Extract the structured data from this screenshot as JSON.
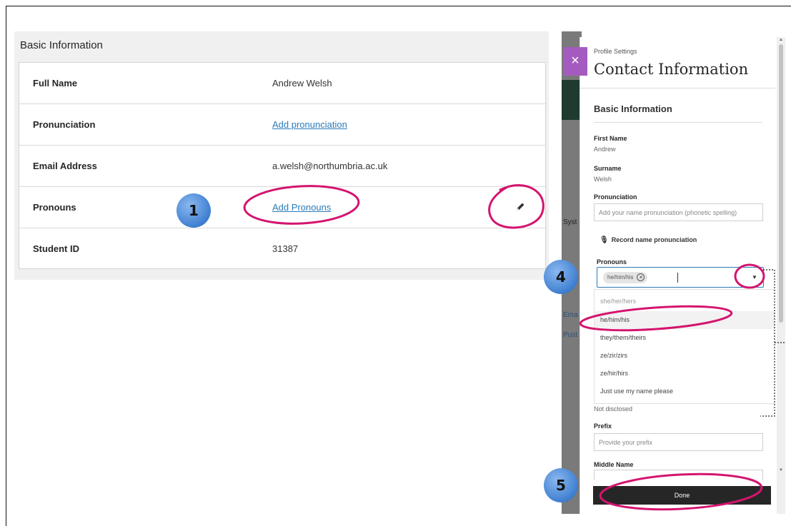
{
  "basic_info": {
    "title": "Basic Information",
    "rows": [
      {
        "label": "Full Name",
        "value": "Andrew Welsh",
        "link": false
      },
      {
        "label": "Pronunciation",
        "value": "Add pronunciation",
        "link": true
      },
      {
        "label": "Email Address",
        "value": "a.welsh@northumbria.ac.uk",
        "link": false
      },
      {
        "label": "Pronouns",
        "value": "Add Pronouns",
        "link": true
      },
      {
        "label": "Student ID",
        "value": "31387",
        "link": false
      }
    ]
  },
  "background_strip": {
    "fragments": [
      "Syst",
      "Ema",
      "Pust"
    ]
  },
  "drawer": {
    "eyebrow": "Profile Settings",
    "title": "Contact Information",
    "close_glyph": "×",
    "section": "Basic Information",
    "first_name_label": "First Name",
    "first_name_value": "Andrew",
    "surname_label": "Surname",
    "surname_value": "Welsh",
    "pronunciation_label": "Pronunciation",
    "pronunciation_placeholder": "Add your name pronunciation (phonetic spelling)",
    "record_label": "Record name pronunciation",
    "pronouns_label": "Pronouns",
    "pronoun_chip": "he/him/his",
    "pronoun_options": [
      "she/her/hers",
      "he/him/his",
      "they/them/theirs",
      "ze/zir/zirs",
      "ze/hir/hirs",
      "Just use my name please"
    ],
    "selected_option": "he/him/his",
    "not_disclosed": "Not disclosed",
    "prefix_label": "Prefix",
    "prefix_placeholder": "Provide your prefix",
    "middle_name_label": "Middle Name",
    "done_label": "Done"
  },
  "annotations": {
    "steps": [
      "1",
      "4",
      "5"
    ],
    "highlight_color": "#d4146f",
    "circle_color": "#4a86d4"
  },
  "icons": {
    "edit": "pencil-icon",
    "close": "close-icon",
    "chip_remove": "remove-chip-icon",
    "dropdown": "chevron-down-icon",
    "microphone": "microphone-icon"
  }
}
